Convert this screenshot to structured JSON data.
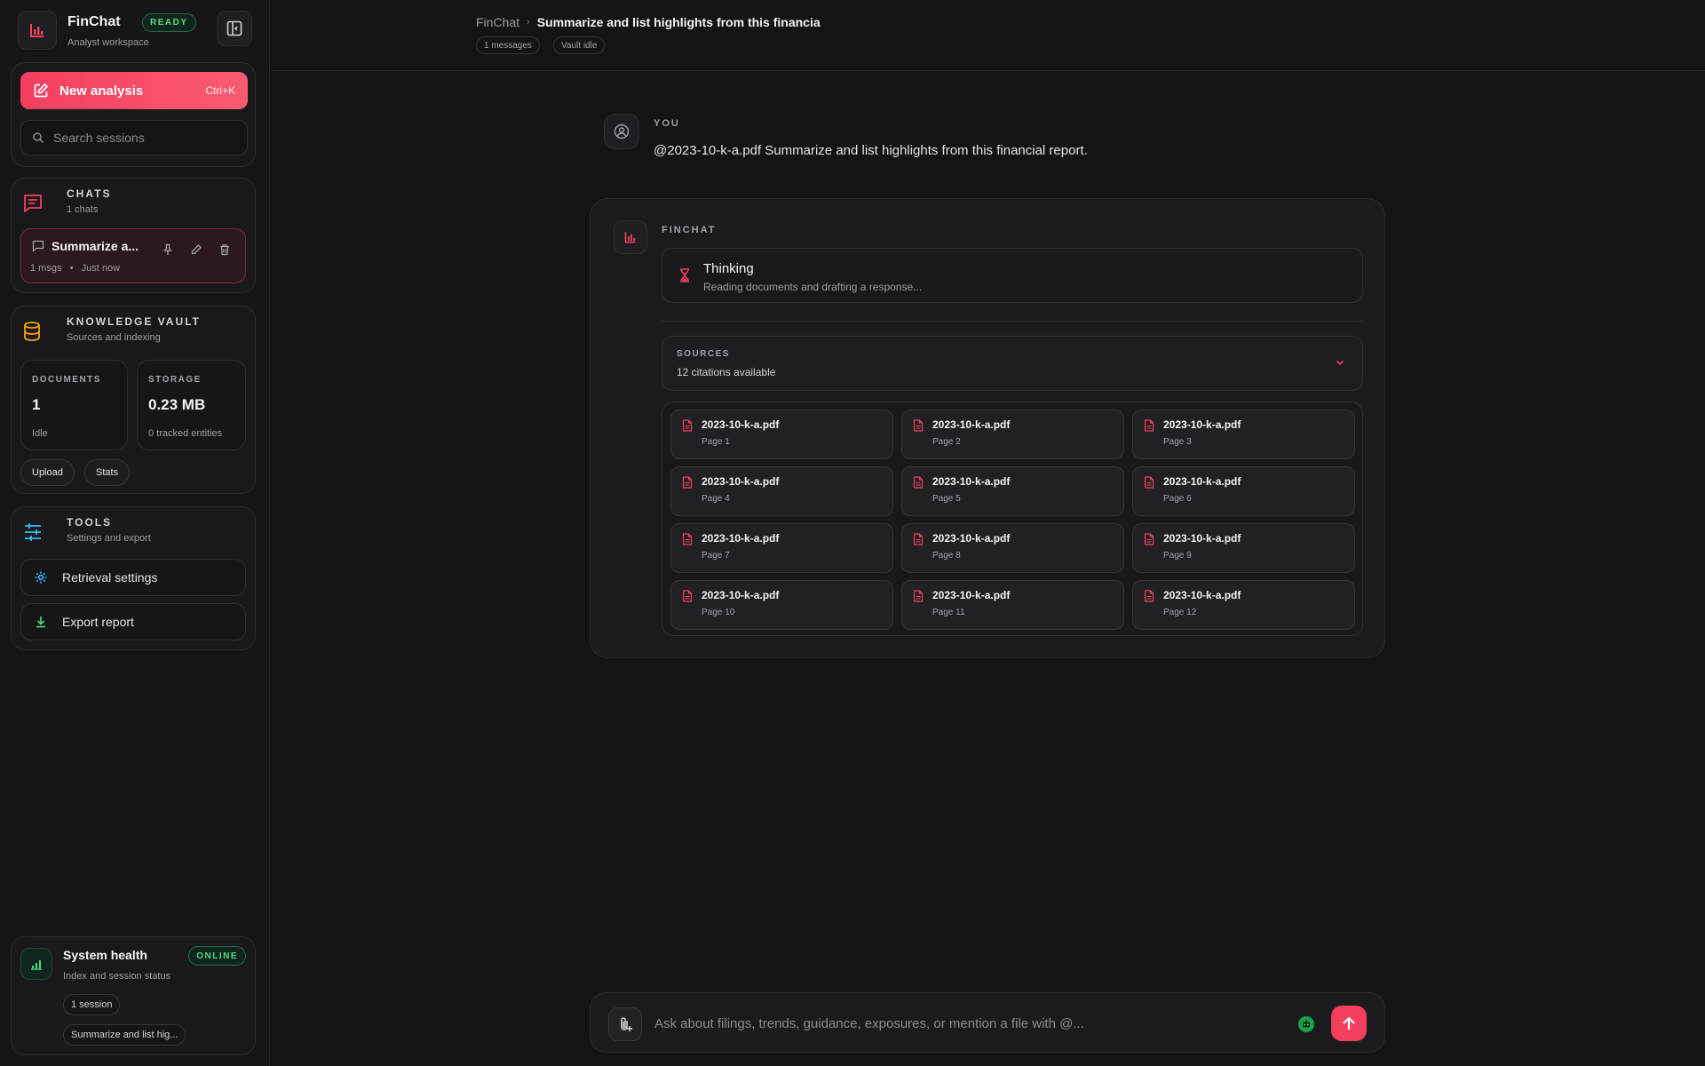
{
  "app": {
    "name": "FinChat",
    "status_badge": "READY",
    "subtitle": "Analyst workspace",
    "accent_color": "#f43f5e",
    "success_color": "#4ade80"
  },
  "sidebar": {
    "new_analysis": {
      "label": "New analysis",
      "shortcut": "Ctrl+K",
      "icon": "edit-icon"
    },
    "search": {
      "placeholder": "Search sessions",
      "value": "",
      "icon": "search-icon"
    },
    "chats": {
      "title": "CHATS",
      "subtitle": "1 chats",
      "icon": "chat-lines-icon",
      "items": [
        {
          "title": "Summarize a...",
          "msgs": "1 msgs",
          "time": "Just now",
          "active": true
        }
      ]
    },
    "vault": {
      "title": "KNOWLEDGE VAULT",
      "subtitle": "Sources and indexing",
      "icon": "database-icon",
      "documents": {
        "label": "DOCUMENTS",
        "value": "1",
        "status": "Idle"
      },
      "storage": {
        "label": "STORAGE",
        "value": "0.23 MB",
        "status": "0 tracked entities"
      },
      "buttons": {
        "upload": "Upload",
        "stats": "Stats"
      }
    },
    "tools": {
      "title": "TOOLS",
      "subtitle": "Settings and export",
      "icon": "sliders-icon",
      "items": [
        {
          "label": "Retrieval settings",
          "icon": "gear-icon"
        },
        {
          "label": "Export report",
          "icon": "download-icon"
        }
      ]
    },
    "health": {
      "title": "System health",
      "subtitle": "Index and session status",
      "badge": "ONLINE",
      "pills": [
        "1 session",
        "Summarize and list hig..."
      ]
    }
  },
  "header": {
    "breadcrumb_root": "FinChat",
    "breadcrumb_current": "Summarize and list highlights from this financia",
    "pills": [
      "1 messages",
      "Vault idle"
    ]
  },
  "conversation": {
    "user": {
      "label": "YOU",
      "text": "@2023-10-k-a.pdf Summarize and list highlights from this financial report."
    },
    "assistant": {
      "label": "FINCHAT",
      "thinking_title": "Thinking",
      "thinking_sub": "Reading documents and drafting a response...",
      "sources_label": "SOURCES",
      "sources_count": "12 citations available",
      "citations": [
        {
          "file": "2023-10-k-a.pdf",
          "page": "Page 1"
        },
        {
          "file": "2023-10-k-a.pdf",
          "page": "Page 2"
        },
        {
          "file": "2023-10-k-a.pdf",
          "page": "Page 3"
        },
        {
          "file": "2023-10-k-a.pdf",
          "page": "Page 4"
        },
        {
          "file": "2023-10-k-a.pdf",
          "page": "Page 5"
        },
        {
          "file": "2023-10-k-a.pdf",
          "page": "Page 6"
        },
        {
          "file": "2023-10-k-a.pdf",
          "page": "Page 7"
        },
        {
          "file": "2023-10-k-a.pdf",
          "page": "Page 8"
        },
        {
          "file": "2023-10-k-a.pdf",
          "page": "Page 9"
        },
        {
          "file": "2023-10-k-a.pdf",
          "page": "Page 10"
        },
        {
          "file": "2023-10-k-a.pdf",
          "page": "Page 11"
        },
        {
          "file": "2023-10-k-a.pdf",
          "page": "Page 12"
        }
      ]
    }
  },
  "composer": {
    "placeholder": "Ask about filings, trends, guidance, exposures, or mention a file with @...",
    "value": ""
  }
}
